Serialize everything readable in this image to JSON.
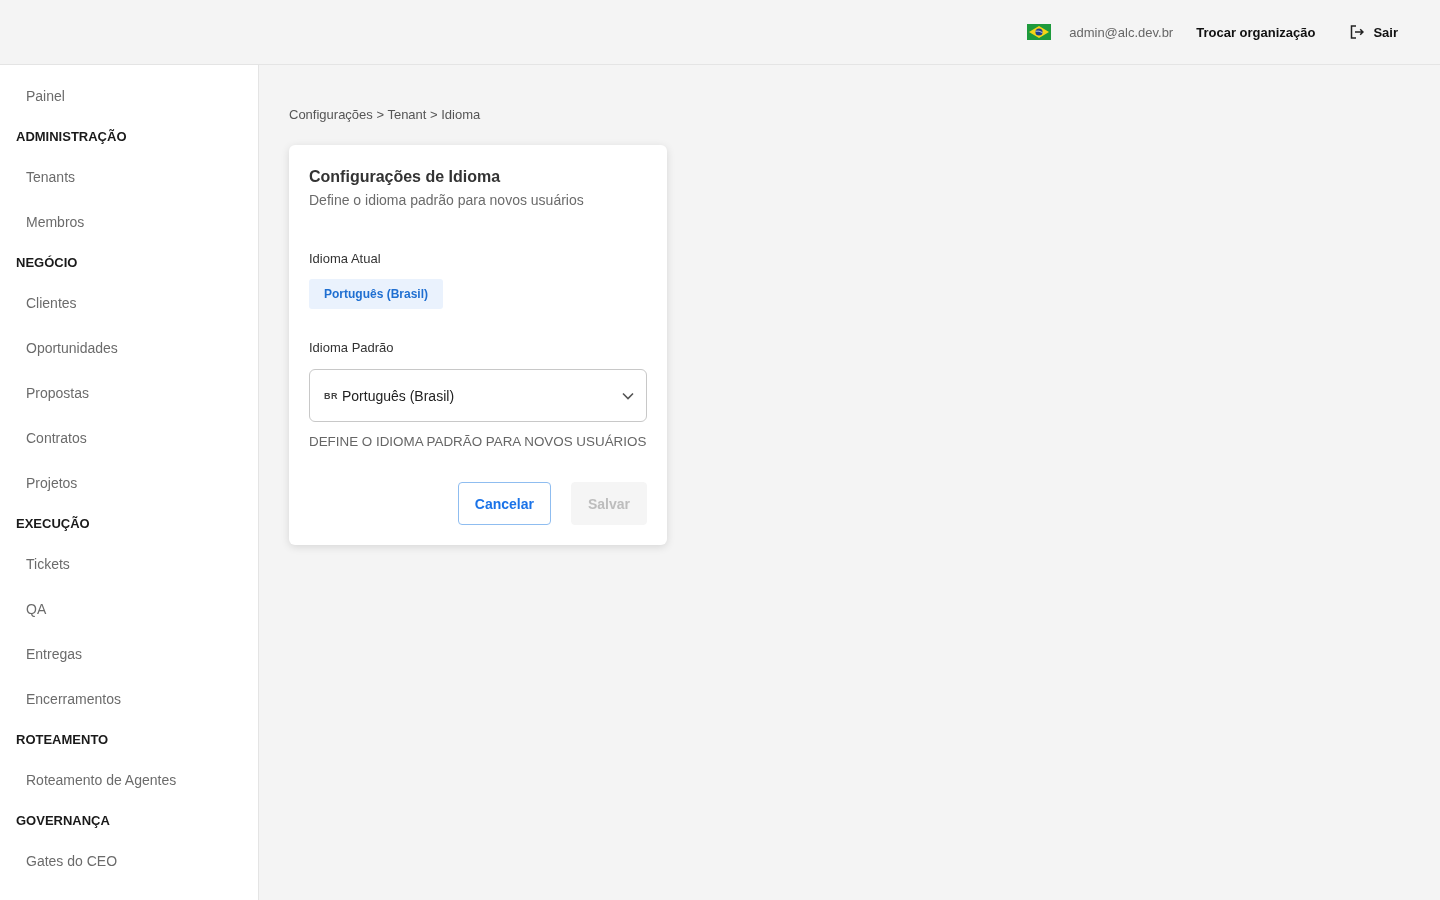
{
  "header": {
    "user_email": "admin@alc.dev.br",
    "switch_org_link": "Trocar organização",
    "logout_button": "Sair"
  },
  "sidebar": {
    "sections": [
      {
        "items": [
          "Painel"
        ]
      },
      {
        "heading": "ADMINISTRAÇÃO",
        "items": [
          "Tenants",
          "Membros"
        ]
      },
      {
        "heading": "NEGÓCIO",
        "items": [
          "Clientes",
          "Oportunidades",
          "Propostas",
          "Contratos",
          "Projetos"
        ]
      },
      {
        "heading": "EXECUÇÃO",
        "items": [
          "Tickets",
          "QA",
          "Entregas",
          "Encerramentos"
        ]
      },
      {
        "heading": "ROTEAMENTO",
        "items": [
          "Roteamento de Agentes"
        ]
      },
      {
        "heading": "GOVERNANÇA",
        "items": [
          "Gates do CEO"
        ]
      }
    ]
  },
  "breadcrumb": "Configurações > Tenant > Idioma",
  "card": {
    "title": "Configurações de Idioma",
    "subtitle": "Define o idioma padrão para novos usuários",
    "current_language": {
      "label": "Idioma Atual",
      "value": "Português (Brasil)"
    },
    "default_language": {
      "label": "Idioma Padrão",
      "flag_code": "BR",
      "value": "Português (Brasil)"
    },
    "helper_text": "DEFINE O IDIOMA PADRÃO PARA NOVOS USUÁRIOS",
    "buttons": [
      {
        "label": "Cancelar",
        "kind": "secondary",
        "disabled": false
      },
      {
        "label": "Salvar",
        "kind": "primary",
        "disabled": true
      }
    ]
  }
}
